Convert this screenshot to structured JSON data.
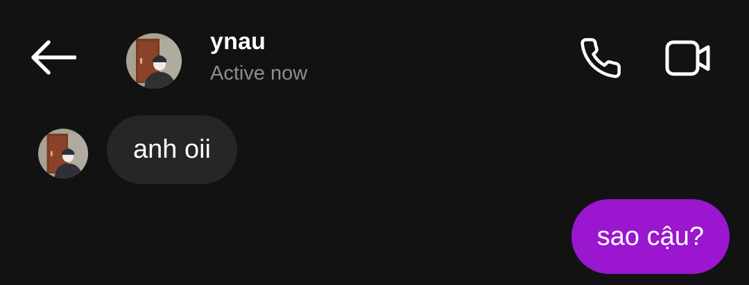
{
  "header": {
    "back_icon": "arrow-left-icon",
    "contact_name": "ynau",
    "status_text": "Active now",
    "call_icon": "phone-icon",
    "video_icon": "video-camera-icon"
  },
  "messages": [
    {
      "direction": "incoming",
      "text": "anh oii"
    },
    {
      "direction": "outgoing",
      "text": "sao cậu?"
    }
  ],
  "colors": {
    "background": "#121212",
    "incoming_bubble": "#262626",
    "outgoing_bubble": "#9b16cf",
    "status_text": "#8e8e8e"
  }
}
